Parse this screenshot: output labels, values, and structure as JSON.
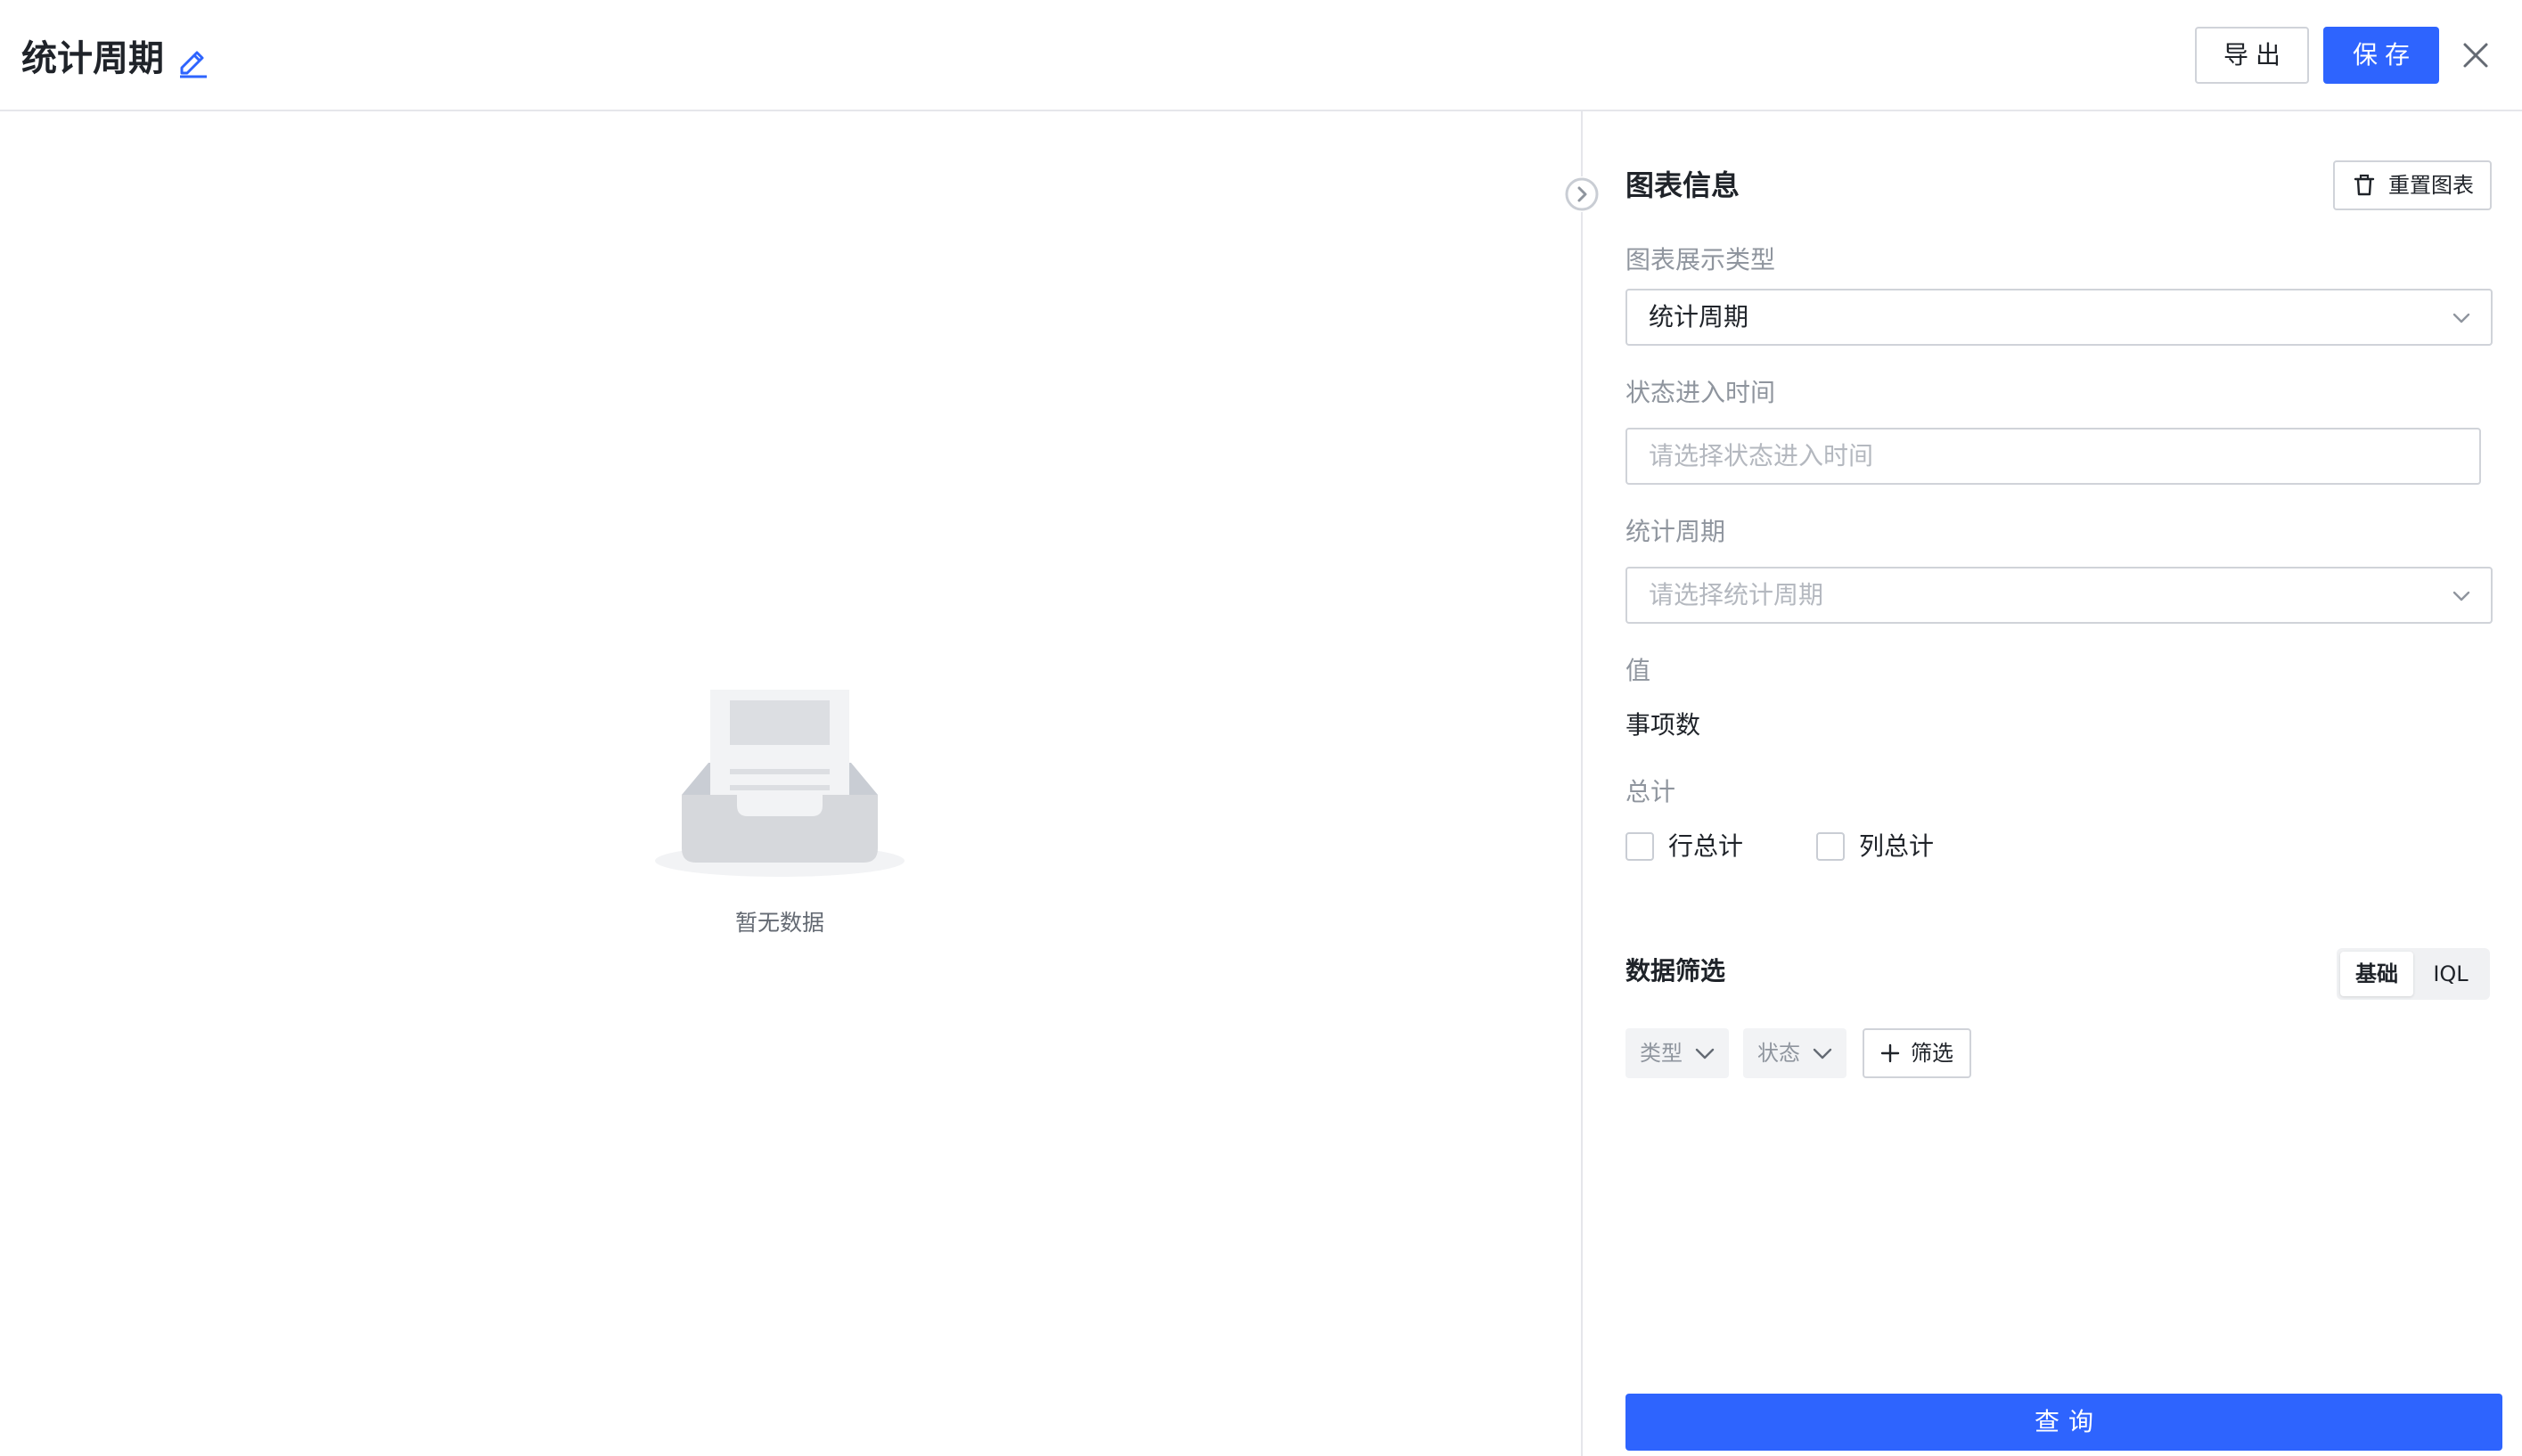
{
  "header": {
    "title": "统计周期",
    "export_label": "导出",
    "save_label": "保存"
  },
  "empty_state": {
    "text": "暂无数据"
  },
  "panel": {
    "title": "图表信息",
    "reset_label": "重置图表",
    "chart_type": {
      "label": "图表展示类型",
      "value": "统计周期"
    },
    "status_time": {
      "label": "状态进入时间",
      "placeholder": "请选择状态进入时间"
    },
    "period": {
      "label": "统计周期",
      "placeholder": "请选择统计周期"
    },
    "value_field": {
      "label": "值",
      "value": "事项数"
    },
    "total": {
      "label": "总计",
      "row_total": "行总计",
      "row_total_checked": false,
      "col_total": "列总计",
      "col_total_checked": false
    },
    "filter": {
      "title": "数据筛选",
      "mode_basic": "基础",
      "mode_iql": "IQL",
      "active_mode": "基础",
      "chips": [
        "类型",
        "状态"
      ],
      "add_label": "筛选"
    },
    "query_label": "查询"
  },
  "colors": {
    "primary": "#2e64fe",
    "border": "#d0d3d9",
    "muted_text": "#8f959e",
    "placeholder": "#b4b8bf"
  }
}
